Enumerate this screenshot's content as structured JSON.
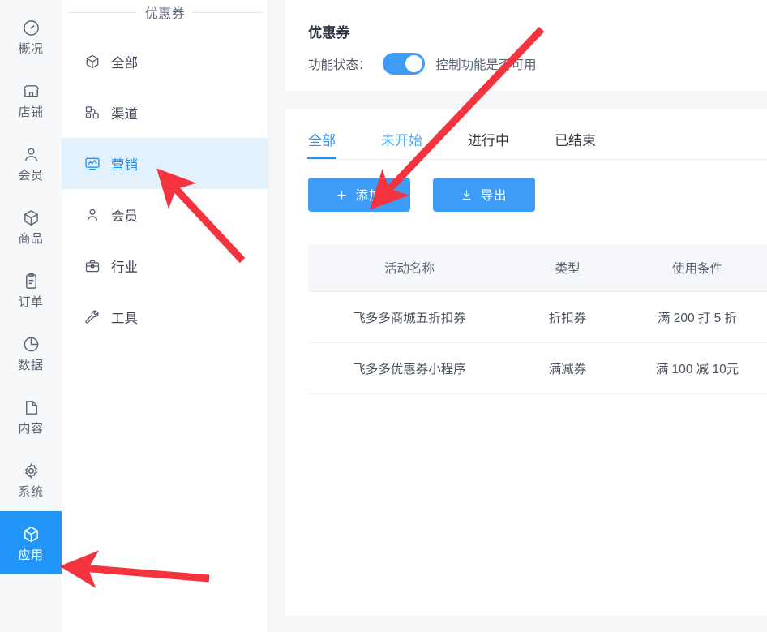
{
  "rail": {
    "items": [
      {
        "label": "概况",
        "icon": "dashboard-icon",
        "active": false
      },
      {
        "label": "店铺",
        "icon": "shop-icon",
        "active": false
      },
      {
        "label": "会员",
        "icon": "user-icon",
        "active": false
      },
      {
        "label": "商品",
        "icon": "box-icon",
        "active": false
      },
      {
        "label": "订单",
        "icon": "clipboard-icon",
        "active": false
      },
      {
        "label": "数据",
        "icon": "pie-chart-icon",
        "active": false
      },
      {
        "label": "内容",
        "icon": "file-icon",
        "active": false
      },
      {
        "label": "系统",
        "icon": "gear-icon",
        "active": false
      },
      {
        "label": "应用",
        "icon": "cube-icon",
        "active": true
      }
    ]
  },
  "panel": {
    "title": "优惠券",
    "items": [
      {
        "label": "全部",
        "icon": "cube-outline-icon",
        "active": false
      },
      {
        "label": "渠道",
        "icon": "channels-icon",
        "active": false
      },
      {
        "label": "营销",
        "icon": "marketing-chart-icon",
        "active": true
      },
      {
        "label": "会员",
        "icon": "member-icon",
        "active": false
      },
      {
        "label": "行业",
        "icon": "briefcase-icon",
        "active": false
      },
      {
        "label": "工具",
        "icon": "wrench-icon",
        "active": false
      }
    ]
  },
  "header": {
    "feature_title": "优惠券",
    "status_label": "功能状态：",
    "switch_on": true,
    "status_hint": "控制功能是否可用"
  },
  "tabs": [
    {
      "label": "全部",
      "state": "active"
    },
    {
      "label": "未开始",
      "state": "hovered"
    },
    {
      "label": "进行中",
      "state": "normal"
    },
    {
      "label": "已结束",
      "state": "normal"
    }
  ],
  "toolbar": {
    "add_label": "添加",
    "add_icon": "plus-icon",
    "export_label": "导出",
    "export_icon": "download-icon"
  },
  "table": {
    "columns": [
      "活动名称",
      "类型",
      "使用条件"
    ],
    "rows": [
      {
        "name": "飞多多商城五折扣券",
        "type": "折扣券",
        "condition": "满 200 打 5 折"
      },
      {
        "name": "飞多多优惠券小程序",
        "type": "满减券",
        "condition": "满 100 减 10元"
      }
    ]
  },
  "colors": {
    "accent": "#2196f8",
    "button": "#3d9cf6",
    "active_panel_bg": "#e3f1fd",
    "page_bg": "#f5f6f8",
    "annotation": "#f5333f"
  },
  "annotations": [
    {
      "name": "arrow-to-marketing",
      "points_to": "营销"
    },
    {
      "name": "arrow-to-add-button",
      "points_to": "添加"
    },
    {
      "name": "arrow-to-apps",
      "points_to": "应用"
    }
  ]
}
